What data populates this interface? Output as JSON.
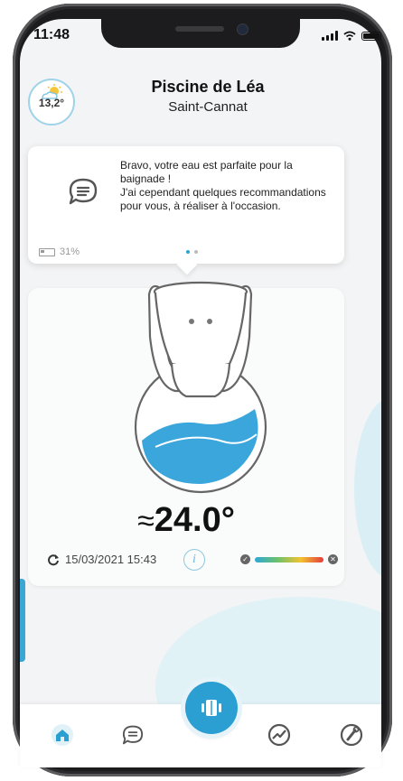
{
  "status_bar": {
    "time": "11:48"
  },
  "weather": {
    "temperature": "13,2°",
    "icon": "sun-cloud-icon"
  },
  "pool": {
    "name": "Piscine de Léa",
    "city": "Saint-Cannat"
  },
  "message": {
    "lines": [
      "Bravo, votre eau est parfaite pour la baignade !",
      "J'ai cependant quelques recommandations pour vous, à réaliser à l'occasion."
    ],
    "battery_level": "31%",
    "pager": {
      "count": 2,
      "active": 0
    }
  },
  "measure": {
    "approx_symbol": "≈",
    "temperature": "24.0°",
    "last_update": "15/03/2021 15:43",
    "info_label": "i"
  },
  "colors": {
    "accent": "#2b9fd1",
    "water": "#3aa6dc",
    "scale_start": "#2ea8d8",
    "scale_end": "#e53d3d"
  },
  "tabs": [
    "home-icon",
    "chat-icon",
    "device-icon",
    "analysis-icon",
    "maintenance-icon"
  ]
}
